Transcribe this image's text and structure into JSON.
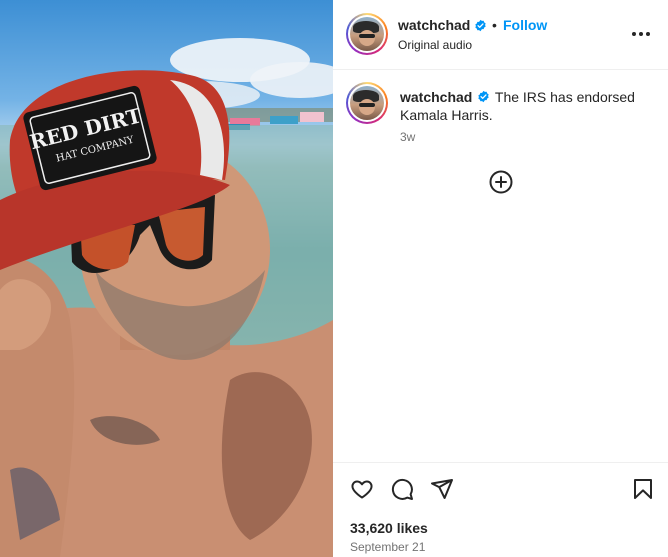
{
  "post": {
    "username": "watchchad",
    "verified": true,
    "follow_label": "Follow",
    "separator": "•",
    "audio_label": "Original audio",
    "caption_user": "watchchad",
    "caption_text": "The IRS has endorsed Kamala Harris.",
    "time_ago": "3w",
    "likes": "33,620 likes",
    "date": "September 21"
  },
  "media": {
    "hat_patch_line1": "RED DIRT",
    "hat_patch_line2": "HAT COMPANY"
  },
  "icons": {
    "more": "more-options-icon",
    "add": "add-circle-icon",
    "like": "heart-icon",
    "comment": "comment-icon",
    "share": "share-icon",
    "save": "bookmark-icon",
    "verified": "verified-badge-icon"
  },
  "colors": {
    "follow": "#0095f6",
    "verified": "#0095f6",
    "text": "#262626",
    "muted": "#737373"
  }
}
